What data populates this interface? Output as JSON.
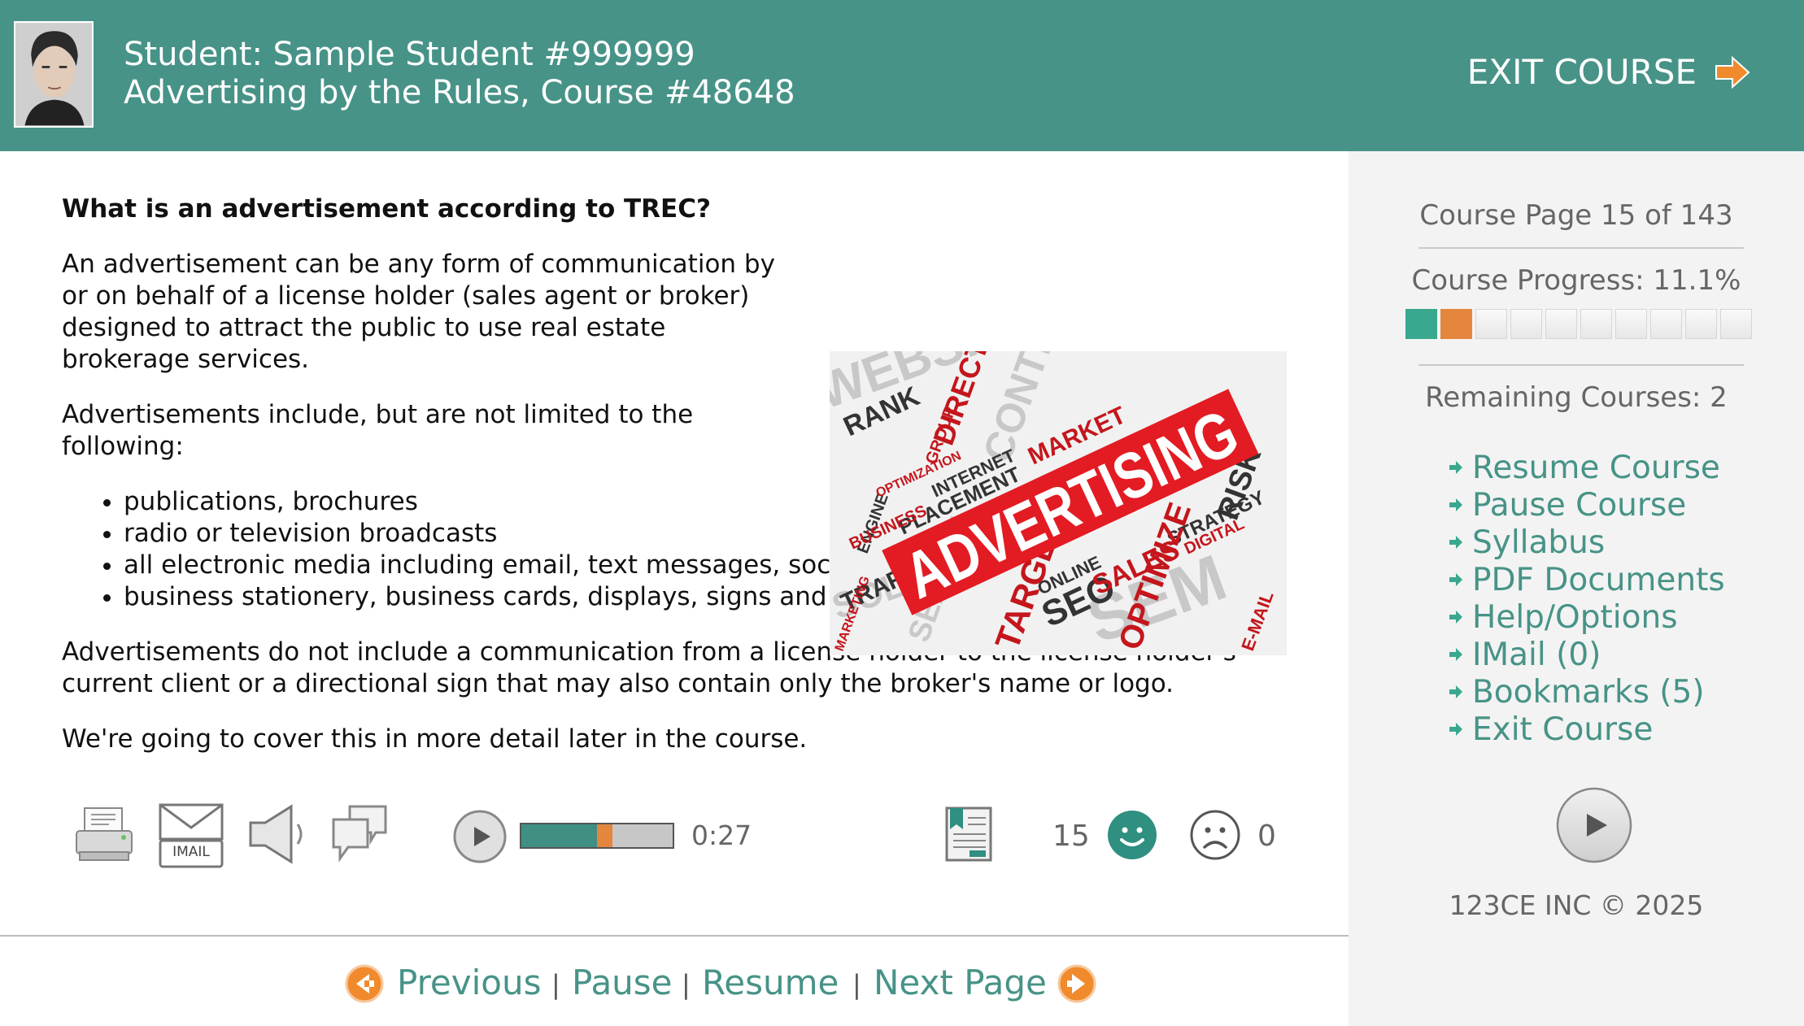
{
  "header": {
    "student": "Student: Sample Student #999999",
    "course": "Advertising by the Rules, Course #48648",
    "exit_label": "EXIT COURSE"
  },
  "content": {
    "question": "What is an advertisement according to TREC?",
    "paragraph1": "An advertisement can be any form of communication by or on behalf of a license holder (sales agent or broker) designed to attract the public to use real estate brokerage services.",
    "paragraph2": "Advertisements include, but are not limited to the following:",
    "bullets": [
      "publications, brochures",
      "radio or television broadcasts",
      "all electronic media including email, text messages, social media, websites",
      "business stationery, business cards, displays, signs and billboards"
    ],
    "paragraph3": "Advertisements do not include a communication from a license holder to the license holder's current client or a directional sign that may also contain only the broker's name or logo.",
    "paragraph4": "We're going to cover this in more detail later in the course.",
    "image_words": {
      "main": "ADVERTISING",
      "w1": "WEBSITE",
      "w2": "RANK",
      "w3": "DIRECT",
      "w4": "CONTENT",
      "w5": "MARKET",
      "w6": "PLACEMENT",
      "w7": "BUSINESS",
      "w8": "SEO",
      "w9": "SALES",
      "w10": "TRAFFIC",
      "w11": "RISK",
      "w12": "TARGET",
      "w13": "OPTIMIZE",
      "w14": "SEM",
      "w15": "ONLINE",
      "w16": "SEARCH",
      "w17": "STRATEGY",
      "w18": "GROUP",
      "w19": "MARKETING",
      "w20": "INTERNET",
      "w21": "OPTIMIZATION",
      "w22": "SOLUTION",
      "w23": "ENGINE",
      "w24": "DIGITAL",
      "w25": "E-MAIL"
    }
  },
  "toolbar": {
    "imail_label": "IMAIL",
    "audio_time": "0:27",
    "audio_played_fraction": 0.5,
    "audio_marker_fraction": 0.1,
    "likes": "15",
    "dislikes": "0"
  },
  "bottom_nav": {
    "previous": "Previous",
    "pause": "Pause",
    "resume": "Resume",
    "next": "Next Page",
    "separator": "|"
  },
  "sidebar": {
    "course_page": "Course Page 15 of 143",
    "course_progress": "Course Progress: 11.1%",
    "progress_fraction": 0.111,
    "progress_boxes_total": 10,
    "progress_boxes_done": 1,
    "progress_boxes_current": 1,
    "remaining": "Remaining Courses: 2",
    "menu": [
      "Resume Course",
      "Pause Course",
      "Syllabus",
      "PDF Documents",
      "Help/Options",
      "IMail (0)",
      "Bookmarks (5)",
      "Exit Course"
    ],
    "copyright": "123CE INC © 2025"
  },
  "colors": {
    "header_bg": "#479387",
    "link": "#479387",
    "accent_orange": "#e4863e",
    "sidebar_bg": "#f3f3f3",
    "ad_red": "#e31b23"
  }
}
